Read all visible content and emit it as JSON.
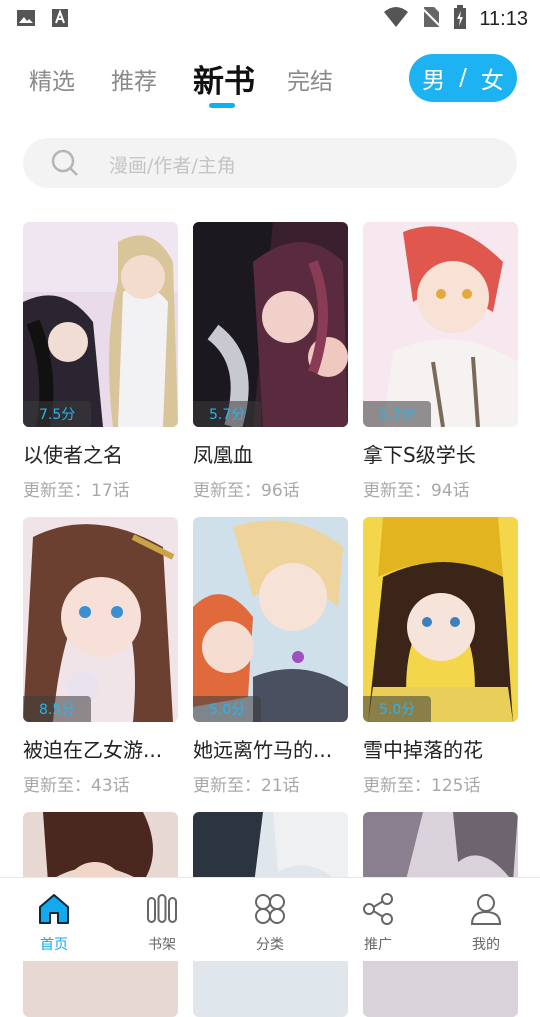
{
  "status_bar": {
    "time": "11:13",
    "icons": [
      "image-icon",
      "font-app-icon",
      "wifi-icon",
      "no-sim-icon",
      "battery-charging-icon"
    ]
  },
  "tabs": [
    {
      "label": "精选",
      "active": false
    },
    {
      "label": "推荐",
      "active": false
    },
    {
      "label": "新书",
      "active": true
    },
    {
      "label": "完结",
      "active": false
    }
  ],
  "gender_toggle": {
    "male": "男",
    "separator": "/",
    "female": "女"
  },
  "search": {
    "placeholder": "漫画/作者/主角"
  },
  "books": [
    {
      "title": "以使者之名",
      "score": "7.5分",
      "update": "更新至：17话"
    },
    {
      "title": "凤凰血",
      "score": "5.7分",
      "update": "更新至：96话"
    },
    {
      "title": "拿下S级学长",
      "score": "5.7分",
      "update": "更新至：94话"
    },
    {
      "title": "被迫在乙女游...",
      "score": "8.5分",
      "update": "更新至：43话"
    },
    {
      "title": "她远离竹马的...",
      "score": "5.0分",
      "update": "更新至：21话"
    },
    {
      "title": "雪中掉落的花",
      "score": "5.0分",
      "update": "更新至：125话"
    }
  ],
  "bottom_nav": [
    {
      "label": "首页",
      "icon": "home-icon",
      "active": true
    },
    {
      "label": "书架",
      "icon": "bookshelf-icon",
      "active": false
    },
    {
      "label": "分类",
      "icon": "category-icon",
      "active": false
    },
    {
      "label": "推广",
      "icon": "share-icon",
      "active": false
    },
    {
      "label": "我的",
      "icon": "profile-icon",
      "active": false
    }
  ]
}
